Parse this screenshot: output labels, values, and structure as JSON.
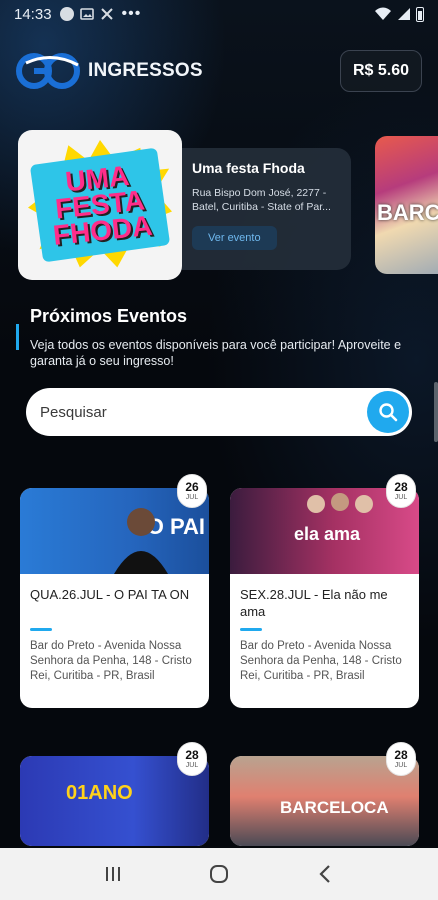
{
  "status": {
    "time": "14:33",
    "dots": "•••"
  },
  "header": {
    "logo_mark": "GO",
    "logo_text": "INGRESSOS",
    "balance": "R$ 5.60"
  },
  "featured": [
    {
      "poster_text": [
        "UMA",
        "FESTA",
        "FHODA"
      ],
      "title": "Uma festa Fhoda",
      "address": "Rua Bispo Dom José, 2277 - Batel, Curitiba - State of Par...",
      "button": "Ver evento"
    },
    {
      "poster_text": "BARC"
    }
  ],
  "section": {
    "title": "Próximos Eventos",
    "description": "Veja todos os eventos disponíveis para você participar! Aproveite e garanta já o seu ingresso!"
  },
  "search": {
    "placeholder": "Pesquisar"
  },
  "events": [
    {
      "day": "26",
      "month": "JUL",
      "title": "QUA.26.JUL - O PAI TA ON",
      "address": "Bar do Preto - Avenida Nossa Senhora da Penha, 148 - Cristo Rei, Curitiba - PR, Brasil",
      "cover_text": "O PAI",
      "cover_color": "#2a7bd6"
    },
    {
      "day": "28",
      "month": "JUL",
      "title": "SEX.28.JUL - Ela não me ama",
      "address": "Bar do Preto - Avenida Nossa Senhora da Penha, 148 - Cristo Rei, Curitiba - PR, Brasil",
      "cover_text": "ela ama",
      "cover_color": "#a53163"
    },
    {
      "day": "28",
      "month": "JUL",
      "title": "",
      "address": "",
      "cover_text": "01ANO",
      "cover_color": "#3550d0"
    },
    {
      "day": "28",
      "month": "JUL",
      "title": "",
      "address": "",
      "cover_text": "BARCELOCA",
      "cover_color": "#e08070"
    }
  ],
  "colors": {
    "accent": "#20a9ee",
    "brand": "#1a6fd6"
  }
}
